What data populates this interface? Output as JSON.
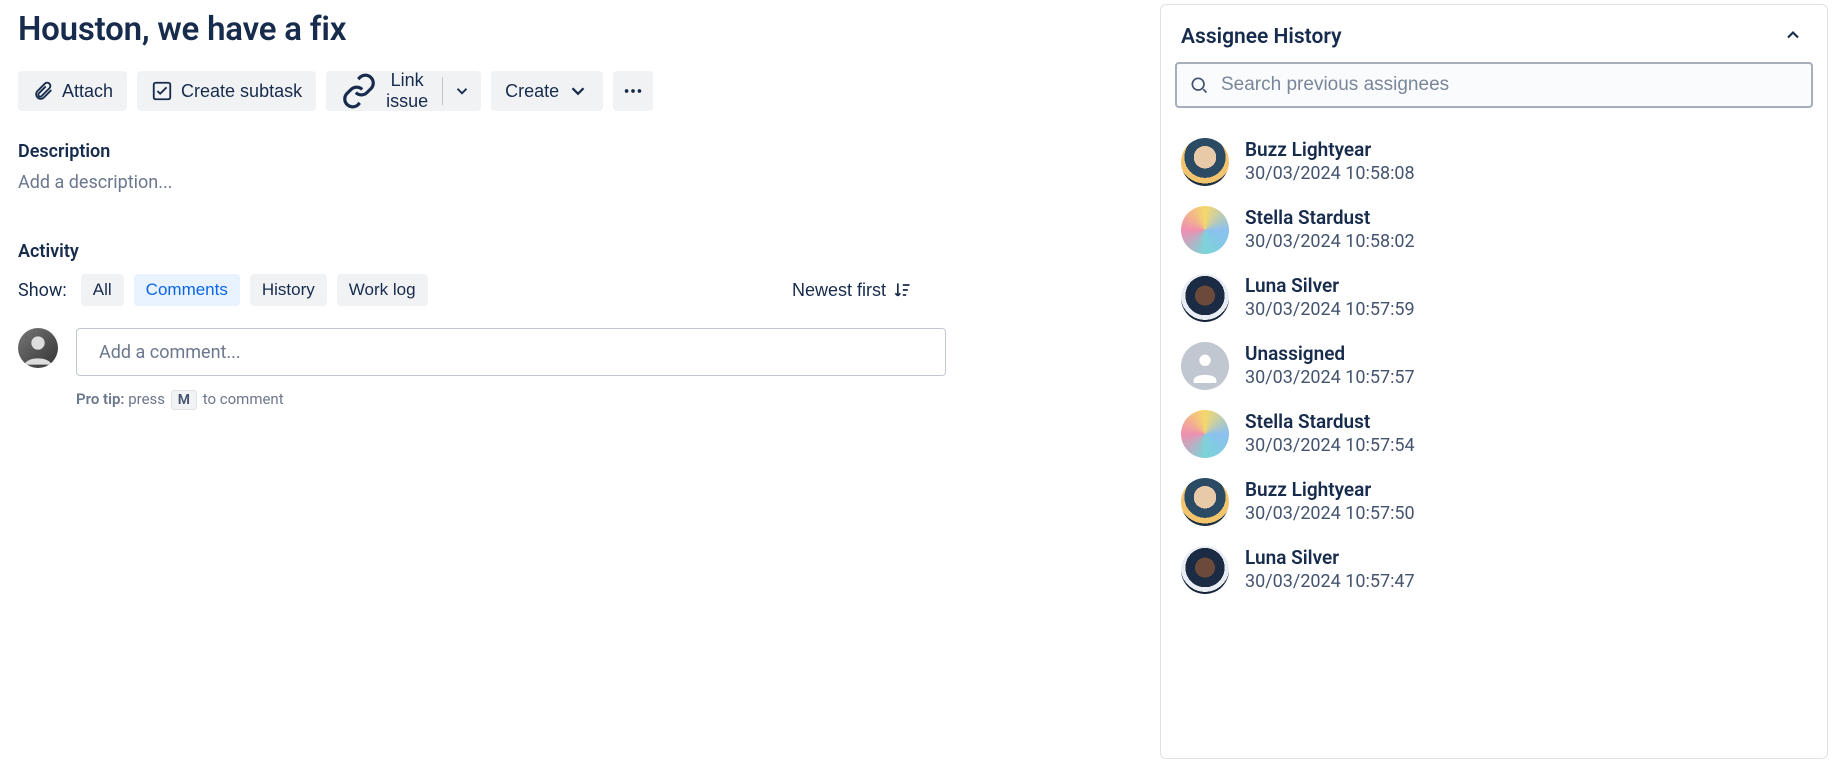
{
  "issue": {
    "title": "Houston, we have a fix"
  },
  "toolbar": {
    "attach": "Attach",
    "create_subtask": "Create subtask",
    "link_issue": "Link issue",
    "create": "Create"
  },
  "description": {
    "heading": "Description",
    "placeholder": "Add a description..."
  },
  "activity": {
    "heading": "Activity",
    "show_label": "Show:",
    "tabs": {
      "all": "All",
      "comments": "Comments",
      "history": "History",
      "worklog": "Work log"
    },
    "sort_label": "Newest first",
    "comment_placeholder": "Add a comment...",
    "protip_label": "Pro tip:",
    "protip_pre": " press ",
    "protip_key": "M",
    "protip_post": " to comment"
  },
  "sidebar": {
    "title": "Assignee History",
    "search_placeholder": "Search previous assignees",
    "items": [
      {
        "name": "Buzz Lightyear",
        "ts": "30/03/2024 10:58:08",
        "avatar": "buzz"
      },
      {
        "name": "Stella Stardust",
        "ts": "30/03/2024 10:58:02",
        "avatar": "stella"
      },
      {
        "name": "Luna Silver",
        "ts": "30/03/2024 10:57:59",
        "avatar": "luna"
      },
      {
        "name": "Unassigned",
        "ts": "30/03/2024 10:57:57",
        "avatar": "unassigned"
      },
      {
        "name": "Stella Stardust",
        "ts": "30/03/2024 10:57:54",
        "avatar": "stella"
      },
      {
        "name": "Buzz Lightyear",
        "ts": "30/03/2024 10:57:50",
        "avatar": "buzz"
      },
      {
        "name": "Luna Silver",
        "ts": "30/03/2024 10:57:47",
        "avatar": "luna"
      }
    ]
  }
}
